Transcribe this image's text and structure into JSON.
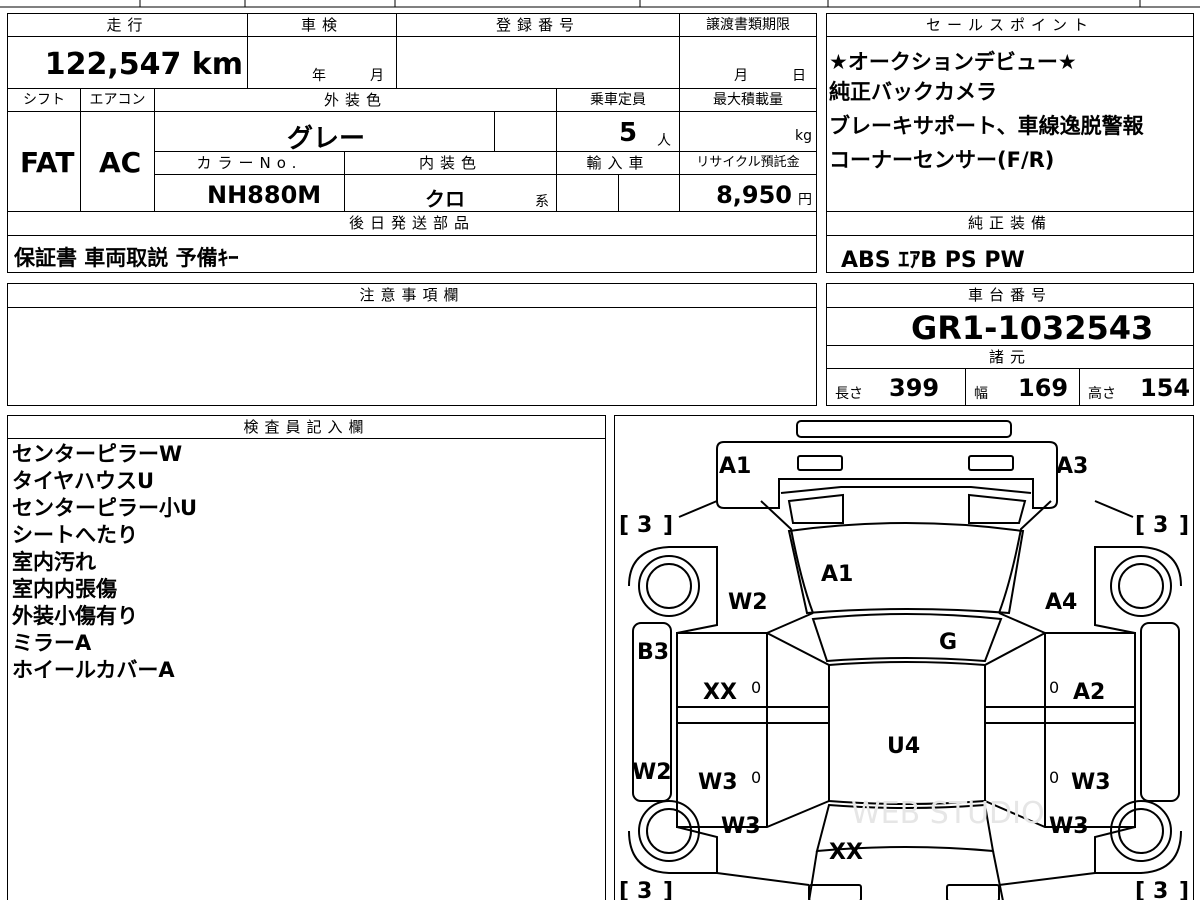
{
  "mileage": {
    "header": "走行",
    "value": "122,547 km"
  },
  "inspection": {
    "header": "車検",
    "year_label": "年",
    "month_label": "月"
  },
  "registration": {
    "header": "登録番号",
    "value": ""
  },
  "transfer_deadline": {
    "header": "譲渡書類期限",
    "month_label": "月",
    "day_label": "日"
  },
  "shift": {
    "header": "シフト",
    "value": "FAT"
  },
  "aircon": {
    "header": "エアコン",
    "value": "AC"
  },
  "exterior_color": {
    "header": "外装色",
    "value": "グレー"
  },
  "capacity": {
    "header": "乗車定員",
    "value": "5",
    "unit": "人"
  },
  "max_load": {
    "header": "最大積載量",
    "value": "",
    "unit": "kg"
  },
  "color_no": {
    "header": "カラーNo.",
    "value": "NH880M"
  },
  "interior_color": {
    "header": "内装色",
    "value": "クロ",
    "suffix": "系"
  },
  "import": {
    "header": "輸入車"
  },
  "recycle": {
    "header": "リサイクル預託金",
    "value": "8,950",
    "unit": "円"
  },
  "shipping_parts": {
    "header": "後日発送部品",
    "value": "保証書 車両取説 予備ｷｰ"
  },
  "sales_points": {
    "header": "セールスポイント",
    "lines": [
      "★オークションデビュー★",
      "純正バックカメラ",
      "ブレーキサポート、車線逸脱警報",
      "コーナーセンサー(F/R)"
    ]
  },
  "equipment": {
    "header": "純正装備",
    "value": "ABS ｴｱB PS PW"
  },
  "notes": {
    "header": "注意事項欄",
    "value": ""
  },
  "chassis": {
    "header": "車台番号",
    "value": "GR1-1032543"
  },
  "specs": {
    "header": "諸元",
    "length_label": "長さ",
    "length": "399",
    "width_label": "幅",
    "width": "169",
    "height_label": "高さ",
    "height": "154"
  },
  "inspector": {
    "header": "検査員記入欄",
    "lines": [
      "センターピラーW",
      "タイヤハウスU",
      "センターピラー小U",
      "シートへたり",
      "室内汚れ",
      "室内内張傷",
      "外装小傷有り",
      "ミラーA",
      "ホイールカバーA"
    ]
  },
  "diagram": {
    "labels": {
      "a1_top": "A1",
      "a3_top": "A3",
      "a1_hood": "A1",
      "w2_left": "W2",
      "a4_right": "A4",
      "b3": "B3",
      "g": "G",
      "xx_left": "XX",
      "a2": "A2",
      "u4": "U4",
      "w2_side": "W2",
      "w3_left": "W3",
      "w3_right": "W3",
      "w3_rear_left": "W3",
      "w3_rear_right": "W3",
      "xx_rear": "XX"
    },
    "tire_marks": {
      "fl": "3",
      "fr": "3",
      "rl": "3",
      "rr": "3"
    },
    "zeros": {
      "left_upper": "0",
      "right_upper": "0",
      "left_lower": "0",
      "right_lower": "0"
    }
  },
  "watermark": "WEB STUDIO"
}
